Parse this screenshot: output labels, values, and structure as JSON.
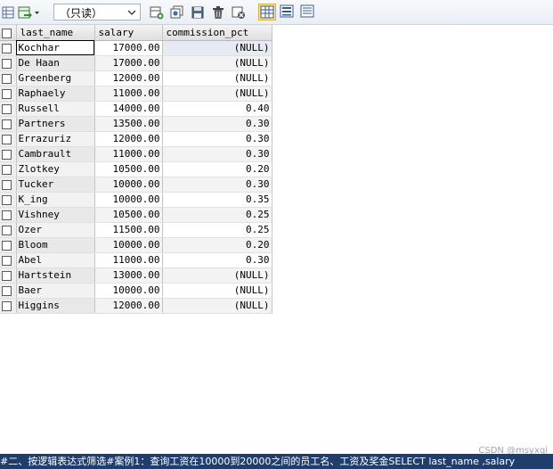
{
  "toolbar": {
    "mode_select": "（只读）"
  },
  "grid": {
    "columns": [
      "last_name",
      "salary",
      "commission_pct"
    ],
    "rows": [
      {
        "last_name": "Kochhar",
        "salary": "17000.00",
        "commission_pct": "(NULL)"
      },
      {
        "last_name": "De Haan",
        "salary": "17000.00",
        "commission_pct": "(NULL)"
      },
      {
        "last_name": "Greenberg",
        "salary": "12000.00",
        "commission_pct": "(NULL)"
      },
      {
        "last_name": "Raphaely",
        "salary": "11000.00",
        "commission_pct": "(NULL)"
      },
      {
        "last_name": "Russell",
        "salary": "14000.00",
        "commission_pct": "0.40"
      },
      {
        "last_name": "Partners",
        "salary": "13500.00",
        "commission_pct": "0.30"
      },
      {
        "last_name": "Errazuriz",
        "salary": "12000.00",
        "commission_pct": "0.30"
      },
      {
        "last_name": "Cambrault",
        "salary": "11000.00",
        "commission_pct": "0.30"
      },
      {
        "last_name": "Zlotkey",
        "salary": "10500.00",
        "commission_pct": "0.20"
      },
      {
        "last_name": "Tucker",
        "salary": "10000.00",
        "commission_pct": "0.30"
      },
      {
        "last_name": "K_ing",
        "salary": "10000.00",
        "commission_pct": "0.35"
      },
      {
        "last_name": "Vishney",
        "salary": "10500.00",
        "commission_pct": "0.25"
      },
      {
        "last_name": "Ozer",
        "salary": "11500.00",
        "commission_pct": "0.25"
      },
      {
        "last_name": "Bloom",
        "salary": "10000.00",
        "commission_pct": "0.20"
      },
      {
        "last_name": "Abel",
        "salary": "11000.00",
        "commission_pct": "0.30"
      },
      {
        "last_name": "Hartstein",
        "salary": "13000.00",
        "commission_pct": "(NULL)"
      },
      {
        "last_name": "Baer",
        "salary": "10000.00",
        "commission_pct": "(NULL)"
      },
      {
        "last_name": "Higgins",
        "salary": "12000.00",
        "commission_pct": "(NULL)"
      }
    ]
  },
  "status_bar": {
    "text": "#二、按逻辑表达式筛选#案例1：查询工资在10000到20000之间的员工名、工资及奖金SELECT   last_name ,salary"
  },
  "watermark": "CSDN @msyxqi",
  "colors": {
    "status_bg": "#1f3e6d",
    "active_view": "#f7e39a"
  }
}
